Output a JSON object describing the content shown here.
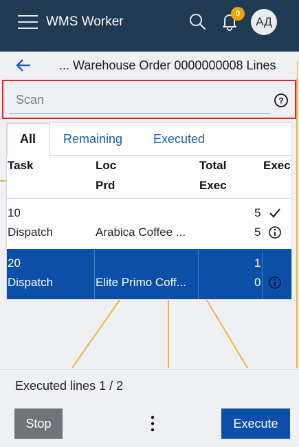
{
  "header": {
    "app_title": "WMS Worker",
    "notification_count": "0",
    "avatar_initials": "АД"
  },
  "subheader": {
    "title": "... Warehouse Order 0000000008 Lines"
  },
  "scan": {
    "placeholder": "Scan",
    "value": ""
  },
  "tabs": [
    {
      "label": "All",
      "active": true
    },
    {
      "label": "Remaining",
      "active": false
    },
    {
      "label": "Executed",
      "active": false
    }
  ],
  "table": {
    "headers": {
      "task": "Task",
      "loc": "Loc",
      "prd": "Prd",
      "total": "Total",
      "exec": "Exec",
      "exec_short": "Exec"
    },
    "rows": [
      {
        "task": "10",
        "type": "Dispatch",
        "loc": "",
        "product": "Arabica Coffee ...",
        "total": "5",
        "exec": "5",
        "status_icon": "check-icon",
        "info_icon": "info-icon",
        "selected": false
      },
      {
        "task": "20",
        "type": "Dispatch",
        "loc": "",
        "product": "Elite Primo Coff...",
        "total": "1",
        "exec": "0",
        "status_icon": "",
        "info_icon": "info-icon",
        "selected": true
      }
    ]
  },
  "footer": {
    "executed_lines": "Executed lines 1 / 2",
    "stop_label": "Stop",
    "execute_label": "Execute"
  },
  "colors": {
    "topbar": "#1f3a52",
    "primary": "#0b4fa8",
    "badge": "#f0a30a",
    "highlight_border": "#e0262b",
    "background_lines": "#f3b23a"
  }
}
